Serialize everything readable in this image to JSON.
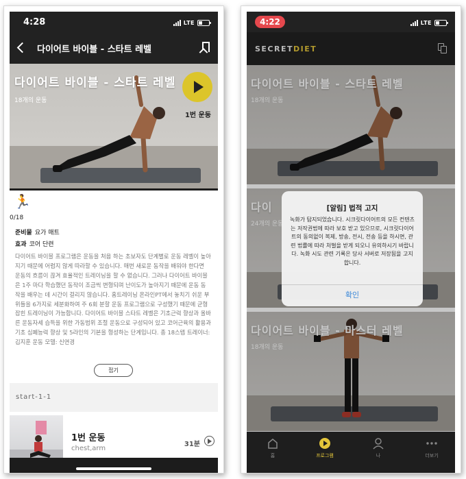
{
  "left": {
    "status": {
      "time": "4:28",
      "network": "LTE"
    },
    "nav": {
      "title": "다이어트 바이블 - 스타트 레벨"
    },
    "hero": {
      "title": "다이어트 바이블 - 스타트 레벨",
      "subtitle": "18개의 운동",
      "play_caption": "1번 운동"
    },
    "progress": {
      "text": "0/18",
      "fraction": 0
    },
    "meta": {
      "prep_label": "준비물",
      "prep_value": "요가 매트",
      "effect_label": "효과",
      "effect_value": "코어 단련"
    },
    "description": "다이어트 바이블 프로그램은 운동을 처음 하는 초보자도 단계별로 운동 레벨이 높아지기 때문에 어렵지 않게 따라할 수 있습니다. 매번 새로운 동작을 배워야 한다면 운동의 흐름이 끊겨 효율적인 트레이닝을 할 수 없습니다. 그러나 다이어트 바이블은 1주 마다 학습했던 동작이 조금씩 변형되며 난이도가 높아지기 때문에 운동 동작을 배우는 데 시간이 걸리지 않습니다. 홈트레이닝 온라인PT에서 놓치기 쉬운 부위들을 6가지로 세분화하여 주 6회 분할 운동 프로그램으로 구성했기 때문에 균형 잡힌 트레이닝이 가능합니다. 다이어트 바이블 스타트 레벨은 기초근력 향상과 올바른 운동자세 습득을 위한 가동범위 조절 운동으로 구성되어 있고 코어근육의 활용과 기초 심폐능력 향상 및 5라인의 기본을 형성하는 단계입니다. 총 18스텝 트레이너: 김지훈 운동 모델: 신연경",
    "collapse_label": "접기",
    "section": {
      "label": "start-1-1"
    },
    "workout": {
      "name": "1번 운동",
      "tags": "chest,arm",
      "duration": "31분"
    }
  },
  "right": {
    "status": {
      "time": "4:22",
      "network": "LTE"
    },
    "brand": {
      "part1": "SECRET",
      "part2": "DIET"
    },
    "cards": [
      {
        "title": "다이어트 바이블 - 스타트 레벨",
        "subtitle": "18개의 운동"
      },
      {
        "title": "다이",
        "subtitle": "24개의 운동"
      },
      {
        "title": "다이어트 바이블 - 마스터 레벨",
        "subtitle": "18개의 운동"
      }
    ],
    "modal": {
      "title": "[알림] 법적 고지",
      "body": "녹화가 탐지되었습니다. 시크릿다이어트의 모든 컨텐츠는 저작권법에 따라 보호 받고 있으므로, 시크릿다이어트의 동의없이 복제, 방송, 전시, 전송 등을 하시면, 관련 법률에 따라 처벌을 받게 되오니 유의하시기 바랍니다. 녹화 시도 관련 기록은 당사 서버로 저장됨을 고지합니다.",
      "ok_label": "확인"
    },
    "tabs": [
      {
        "label": "홈",
        "icon": "home-icon"
      },
      {
        "label": "프로그램",
        "icon": "play-circle-icon",
        "active": true
      },
      {
        "label": "나",
        "icon": "person-icon"
      },
      {
        "label": "더보기",
        "icon": "more-icon"
      }
    ]
  },
  "colors": {
    "accent": "#dcc52a",
    "dark": "#222222",
    "link": "#3b87d8"
  }
}
